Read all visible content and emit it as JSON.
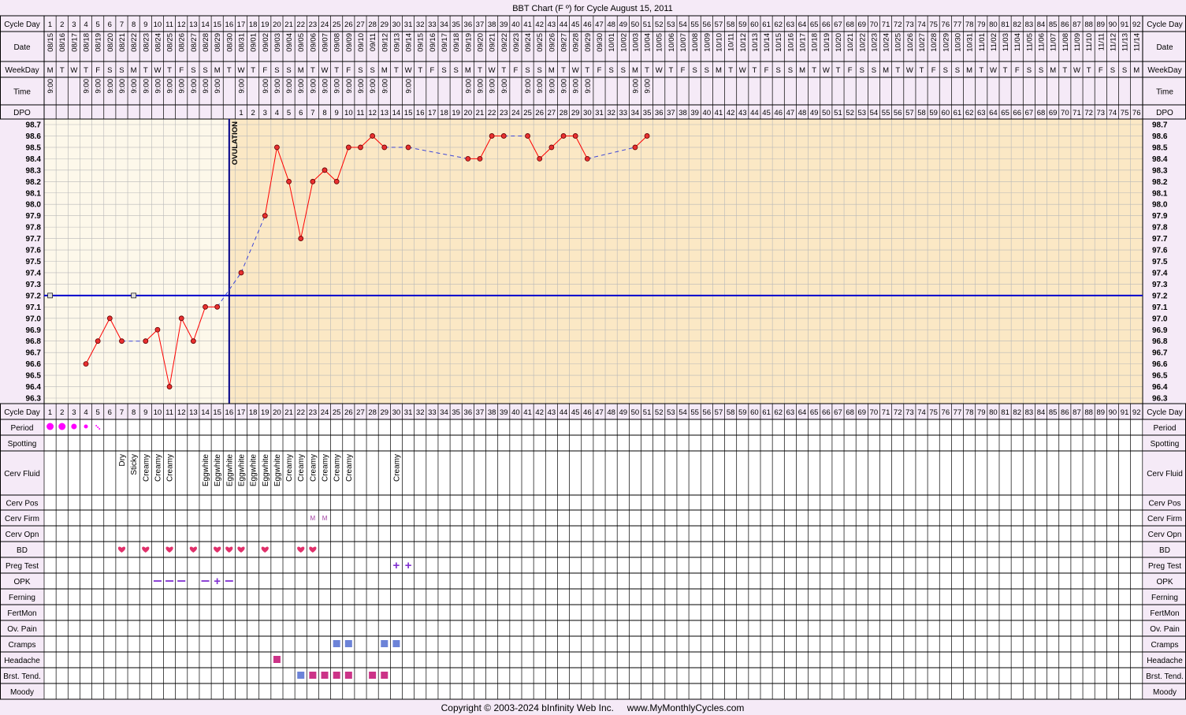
{
  "title": "BBT Chart (F º) for Cycle August 15, 2011",
  "copyright": "Copyright © 2003-2024 bInfinity Web Inc.     www.MyMonthlyCycles.com",
  "header_labels": {
    "cycle_day": "Cycle Day",
    "date": "Date",
    "weekday": "WeekDay",
    "time": "Time",
    "dpo": "DPO"
  },
  "bottom_labels": [
    "Cycle Day",
    "Period",
    "Spotting",
    "Cerv Fluid",
    "Cerv Pos",
    "Cerv Firm",
    "Cerv Opn",
    "BD",
    "Preg Test",
    "OPK",
    "Ferning",
    "FertMon",
    "Ov. Pain",
    "Cramps",
    "Headache",
    "Brst. Tend.",
    "Moody"
  ],
  "ovulation_label": "OVULATION",
  "colors": {
    "background": "#f5eaf7",
    "pre_ovulation": "#fdf8ea",
    "post_ovulation": "#fbe8c5",
    "grid": "#b8b8b8",
    "coverline": "#0000cc",
    "temp_line": "#ff0000",
    "marker_fill": "#e83030",
    "heart": "#e0306a",
    "period": "#ff00ff",
    "test": "#8030d0",
    "cramps": "#6c83d8",
    "pink_square": "#cc3388"
  },
  "chart_data": {
    "type": "line",
    "title": "BBT Chart (F º) for Cycle August 15, 2011",
    "xlabel": "Cycle Day",
    "ylabel": "",
    "ylim": [
      96.3,
      98.7
    ],
    "x": [
      1,
      2,
      3,
      4,
      5,
      6,
      7,
      8,
      9,
      10,
      11,
      12,
      13,
      14,
      15,
      16,
      17,
      18,
      19,
      20,
      21,
      22,
      23,
      24,
      25,
      26,
      27,
      28,
      29,
      30,
      31,
      32,
      33,
      34,
      35,
      36,
      37,
      38,
      39,
      40,
      41,
      42,
      43,
      44,
      45,
      46,
      47,
      48,
      49,
      50,
      51,
      52,
      53,
      54,
      55,
      56,
      57,
      58,
      59,
      60,
      61,
      62,
      63,
      64,
      65,
      66,
      67,
      68,
      69,
      70,
      71,
      72,
      73,
      74,
      75,
      76,
      77,
      78,
      79,
      80,
      81,
      82,
      83,
      84,
      85,
      86,
      87,
      88,
      89,
      90,
      91,
      92
    ],
    "dates": [
      "08/15",
      "08/16",
      "08/17",
      "08/18",
      "08/19",
      "08/20",
      "08/21",
      "08/22",
      "08/23",
      "08/24",
      "08/25",
      "08/26",
      "08/27",
      "08/28",
      "08/29",
      "08/30",
      "08/31",
      "09/01",
      "09/02",
      "09/03",
      "09/04",
      "09/05",
      "09/06",
      "09/07",
      "09/08",
      "09/09",
      "09/10",
      "09/11",
      "09/12",
      "09/13",
      "09/14",
      "09/15",
      "09/16",
      "09/17",
      "09/18",
      "09/19",
      "09/20",
      "09/21",
      "09/22",
      "09/23",
      "09/24",
      "09/25",
      "09/26",
      "09/27",
      "09/28",
      "09/29",
      "09/30",
      "10/01",
      "10/02",
      "10/03",
      "10/04",
      "10/05",
      "10/06",
      "10/07",
      "10/08",
      "10/09",
      "10/10",
      "10/11",
      "10/12",
      "10/13",
      "10/14",
      "10/15",
      "10/16",
      "10/17",
      "10/18",
      "10/19",
      "10/20",
      "10/21",
      "10/22",
      "10/23",
      "10/24",
      "10/25",
      "10/26",
      "10/27",
      "10/28",
      "10/29",
      "10/30",
      "10/31",
      "11/01",
      "11/02",
      "11/03",
      "11/04",
      "11/05",
      "11/06",
      "11/07",
      "11/08",
      "11/09",
      "11/10",
      "11/11",
      "11/12",
      "11/13",
      "11/14"
    ],
    "weekdays": [
      "M",
      "T",
      "W",
      "T",
      "F",
      "S",
      "S",
      "M",
      "T",
      "W",
      "T",
      "F",
      "S",
      "S",
      "M",
      "T",
      "W",
      "T",
      "F",
      "S",
      "S",
      "M",
      "T",
      "W",
      "T",
      "F",
      "S",
      "S",
      "M",
      "T",
      "W",
      "T",
      "F",
      "S",
      "S",
      "M",
      "T",
      "W",
      "T",
      "F",
      "S",
      "S",
      "M",
      "T",
      "W",
      "T",
      "F",
      "S",
      "S",
      "M",
      "T",
      "W",
      "T",
      "F",
      "S",
      "S",
      "M",
      "T",
      "W",
      "T",
      "F",
      "S",
      "S",
      "M",
      "T",
      "W",
      "T",
      "F",
      "S",
      "S",
      "M",
      "T",
      "W",
      "T",
      "F",
      "S",
      "S",
      "M",
      "T",
      "W",
      "T",
      "F",
      "S",
      "S",
      "M",
      "T",
      "W",
      "T",
      "F",
      "S",
      "S",
      "M"
    ],
    "times": [
      "9:00",
      "",
      "",
      "9:00",
      "9:00",
      "9:00",
      "9:00",
      "9:00",
      "9:00",
      "9:00",
      "9:00",
      "9:00",
      "9:00",
      "9:00",
      "9:00",
      "",
      "9:00",
      "",
      "9:00",
      "9:00",
      "9:00",
      "9:00",
      "9:00",
      "9:00",
      "9:00",
      "9:00",
      "9:00",
      "9:00",
      "9:00",
      "",
      "9:00",
      "",
      "",
      "",
      "",
      "9:00",
      "9:00",
      "9:00",
      "9:00",
      "",
      "9:00",
      "9:00",
      "9:00",
      "9:00",
      "9:00",
      "9:00",
      "",
      "",
      "",
      "9:00",
      "9:00",
      "",
      "",
      "",
      "",
      "",
      "",
      "",
      "",
      "",
      "",
      "",
      "",
      "",
      "",
      "",
      "",
      "",
      "",
      "",
      "",
      "",
      "",
      "",
      "",
      "",
      "",
      "",
      "",
      "",
      "",
      "",
      "",
      "",
      "",
      "",
      "",
      "",
      "",
      "",
      "",
      ""
    ],
    "dpo_start_day": 17,
    "dpo_count": 76,
    "y_ticks": [
      "98.7",
      "98.6",
      "98.5",
      "98.4",
      "98.3",
      "98.2",
      "98.1",
      "98.0",
      "97.9",
      "97.8",
      "97.7",
      "97.6",
      "97.5",
      "97.4",
      "97.3",
      "97.2",
      "97.1",
      "97.0",
      "96.9",
      "96.8",
      "96.7",
      "96.6",
      "96.5",
      "96.4",
      "96.3"
    ],
    "temperatures": [
      {
        "day": 4,
        "temp": 96.6
      },
      {
        "day": 5,
        "temp": 96.8
      },
      {
        "day": 6,
        "temp": 97.0
      },
      {
        "day": 7,
        "temp": 96.8
      },
      {
        "day": 9,
        "temp": 96.8
      },
      {
        "day": 10,
        "temp": 96.9
      },
      {
        "day": 11,
        "temp": 96.4
      },
      {
        "day": 12,
        "temp": 97.0
      },
      {
        "day": 13,
        "temp": 96.8
      },
      {
        "day": 14,
        "temp": 97.1
      },
      {
        "day": 15,
        "temp": 97.1
      },
      {
        "day": 17,
        "temp": 97.4
      },
      {
        "day": 19,
        "temp": 97.9
      },
      {
        "day": 20,
        "temp": 98.5
      },
      {
        "day": 21,
        "temp": 98.2
      },
      {
        "day": 22,
        "temp": 97.7
      },
      {
        "day": 23,
        "temp": 98.2
      },
      {
        "day": 24,
        "temp": 98.3
      },
      {
        "day": 25,
        "temp": 98.2
      },
      {
        "day": 26,
        "temp": 98.5
      },
      {
        "day": 27,
        "temp": 98.5
      },
      {
        "day": 28,
        "temp": 98.6
      },
      {
        "day": 29,
        "temp": 98.5
      },
      {
        "day": 31,
        "temp": 98.5
      },
      {
        "day": 36,
        "temp": 98.4
      },
      {
        "day": 37,
        "temp": 98.4
      },
      {
        "day": 38,
        "temp": 98.6
      },
      {
        "day": 39,
        "temp": 98.6
      },
      {
        "day": 41,
        "temp": 98.6
      },
      {
        "day": 42,
        "temp": 98.4
      },
      {
        "day": 43,
        "temp": 98.5
      },
      {
        "day": 44,
        "temp": 98.6
      },
      {
        "day": 45,
        "temp": 98.6
      },
      {
        "day": 46,
        "temp": 98.4
      },
      {
        "day": 50,
        "temp": 98.5
      },
      {
        "day": 51,
        "temp": 98.6
      }
    ],
    "excluded_days": [
      1,
      8
    ],
    "excluded_temp": 97.2,
    "coverline": 97.2,
    "ovulation_day": 16,
    "period": [
      {
        "day": 1,
        "size": "large"
      },
      {
        "day": 2,
        "size": "large"
      },
      {
        "day": 3,
        "size": "medium"
      },
      {
        "day": 4,
        "size": "small"
      },
      {
        "day": 5,
        "size": "spotting"
      }
    ],
    "cerv_fluid": [
      {
        "day": 7,
        "text": "Dry"
      },
      {
        "day": 8,
        "text": "Sticky"
      },
      {
        "day": 9,
        "text": "Creamy"
      },
      {
        "day": 10,
        "text": "Creamy"
      },
      {
        "day": 11,
        "text": "Creamy"
      },
      {
        "day": 14,
        "text": "Eggwhite"
      },
      {
        "day": 15,
        "text": "Eggwhite"
      },
      {
        "day": 16,
        "text": "Eggwhite"
      },
      {
        "day": 17,
        "text": "Eggwhite"
      },
      {
        "day": 18,
        "text": "Eggwhite"
      },
      {
        "day": 19,
        "text": "Eggwhite"
      },
      {
        "day": 20,
        "text": "Eggwhite"
      },
      {
        "day": 21,
        "text": "Creamy"
      },
      {
        "day": 22,
        "text": "Creamy"
      },
      {
        "day": 23,
        "text": "Creamy"
      },
      {
        "day": 24,
        "text": "Creamy"
      },
      {
        "day": 25,
        "text": "Creamy"
      },
      {
        "day": 26,
        "text": "Creamy"
      },
      {
        "day": 30,
        "text": "Creamy"
      }
    ],
    "cerv_firm": [
      {
        "day": 23,
        "text": "M"
      },
      {
        "day": 24,
        "text": "M"
      }
    ],
    "bd_days": [
      7,
      9,
      11,
      13,
      15,
      16,
      17,
      19,
      22,
      23
    ],
    "preg_test": [
      {
        "day": 30,
        "result": "+"
      },
      {
        "day": 31,
        "result": "+"
      }
    ],
    "opk": [
      {
        "day": 10,
        "result": "-"
      },
      {
        "day": 11,
        "result": "-"
      },
      {
        "day": 12,
        "result": "-"
      },
      {
        "day": 14,
        "result": "-"
      },
      {
        "day": 15,
        "result": "+"
      },
      {
        "day": 16,
        "result": "-"
      }
    ],
    "cramps_days": [
      25,
      26,
      29,
      30
    ],
    "headache_days": [
      20
    ],
    "brst_tend": [
      {
        "day": 22,
        "color": "blue"
      },
      {
        "day": 23,
        "color": "pink"
      },
      {
        "day": 24,
        "color": "pink"
      },
      {
        "day": 25,
        "color": "pink"
      },
      {
        "day": 26,
        "color": "pink"
      },
      {
        "day": 28,
        "color": "pink"
      },
      {
        "day": 29,
        "color": "pink"
      }
    ]
  }
}
